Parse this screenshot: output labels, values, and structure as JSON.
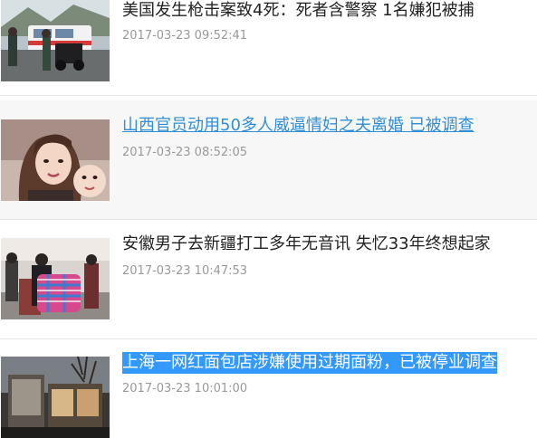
{
  "news": [
    {
      "title": "美国发生枪击案致4死：死者含警察 1名嫌犯被捕",
      "time": "2017-03-23 09:52:41",
      "image": "police-scene-photo"
    },
    {
      "title": "山西官员动用50多人威逼情妇之夫离婚 已被调查",
      "time": "2017-03-23 08:52:05",
      "image": "woman-and-child-photo"
    },
    {
      "title": "安徽男子去新疆打工多年无音讯 失忆33年终想起家",
      "time": "2017-03-23 10:47:53",
      "image": "crowd-with-luggage-photo"
    },
    {
      "title": "上海一网红面包店涉嫌使用过期面粉，已被停业调查",
      "time": "2017-03-23 10:01:00",
      "image": "bakery-storefront-photo"
    }
  ],
  "colors": {
    "link": "#2f8fd6",
    "selection": "#3399ff",
    "timestamp": "#999999",
    "hover_bg": "#f7f7f7"
  }
}
